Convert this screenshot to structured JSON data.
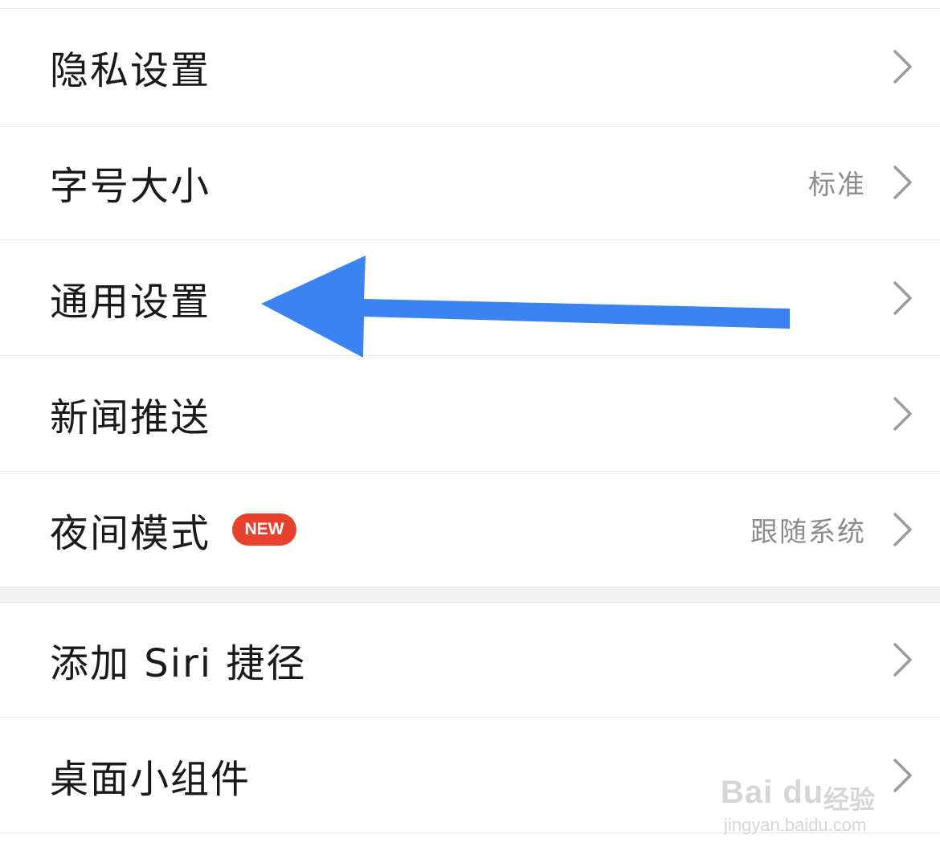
{
  "settings": {
    "items": [
      {
        "label": "隐私设置",
        "value": ""
      },
      {
        "label": "字号大小",
        "value": "标准"
      },
      {
        "label": "通用设置",
        "value": ""
      },
      {
        "label": "新闻推送",
        "value": ""
      },
      {
        "label": "夜间模式",
        "value": "跟随系统",
        "badge": "NEW"
      },
      {
        "label": "添加 Siri 捷径",
        "value": ""
      },
      {
        "label": "桌面小组件",
        "value": ""
      }
    ]
  },
  "colors": {
    "arrow": "#3a83f1",
    "badge": "#e8412d",
    "chevron": "#9b9b9b",
    "divider": "#e6e6e6",
    "section_gap": "#f2f2f2"
  },
  "icons": {
    "chevron": "chevron-right-icon",
    "annotation": "arrow-left-icon"
  },
  "watermark": {
    "brand": "Bai du",
    "sub": "经验",
    "url": "jingyan.baidu.com"
  }
}
